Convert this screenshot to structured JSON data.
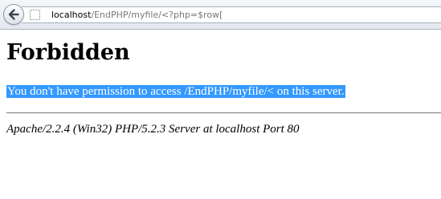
{
  "toolbar": {
    "back_icon": "back-arrow-icon",
    "site_identity_icon": "dotted-square-icon",
    "url": {
      "host": "localhost",
      "path": "/EndPHP/myfile/<?php=$row["
    }
  },
  "page": {
    "title": "Forbidden",
    "message": "You don't have permission to access /EndPHP/myfile/< on this server.",
    "signature": "Apache/2.2.4 (Win32) PHP/5.2.3 Server at localhost Port 80"
  },
  "colors": {
    "selection_background": "#3399ff",
    "selection_text": "#ffffff"
  }
}
